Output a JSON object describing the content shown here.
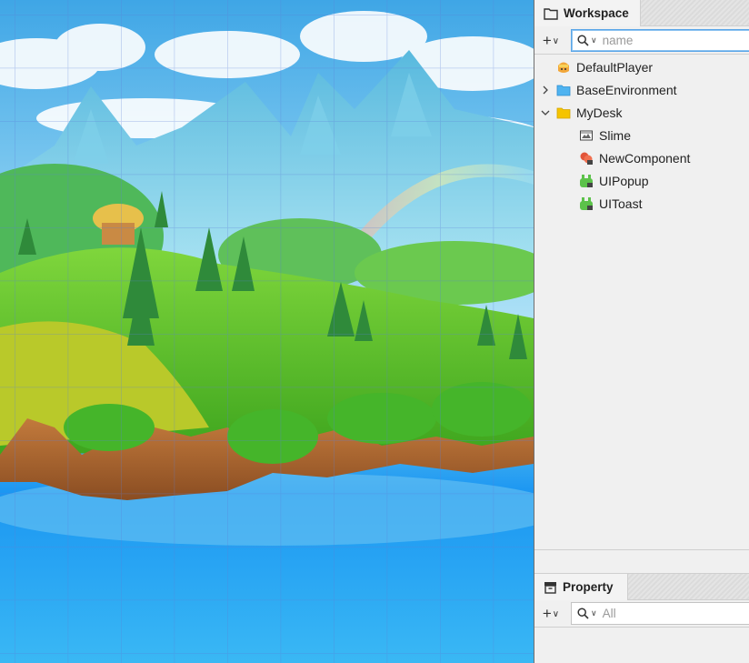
{
  "workspace": {
    "tab_label": "Workspace",
    "add_symbol": "+",
    "search_placeholder": "name",
    "tree": [
      {
        "label": "DefaultPlayer",
        "icon": "player-icon",
        "depth": 0,
        "expander": "none"
      },
      {
        "label": "BaseEnvironment",
        "icon": "folder-blue-icon",
        "depth": 0,
        "expander": "collapsed"
      },
      {
        "label": "MyDesk",
        "icon": "folder-yellow-icon",
        "depth": 0,
        "expander": "expanded"
      },
      {
        "label": "Slime",
        "icon": "sprite-icon",
        "depth": 1,
        "expander": "none"
      },
      {
        "label": "NewComponent",
        "icon": "component-icon",
        "depth": 1,
        "expander": "none"
      },
      {
        "label": "UIPopup",
        "icon": "ui-icon",
        "depth": 1,
        "expander": "none"
      },
      {
        "label": "UIToast",
        "icon": "ui-icon",
        "depth": 1,
        "expander": "none"
      }
    ]
  },
  "property": {
    "tab_label": "Property",
    "add_symbol": "+",
    "search_placeholder": "All"
  },
  "colors": {
    "accent": "#5aa6e8",
    "folder_blue": "#4fb3f0",
    "folder_yellow": "#f5c400",
    "ui_green": "#5cc24a",
    "component_red": "#e2553a"
  }
}
